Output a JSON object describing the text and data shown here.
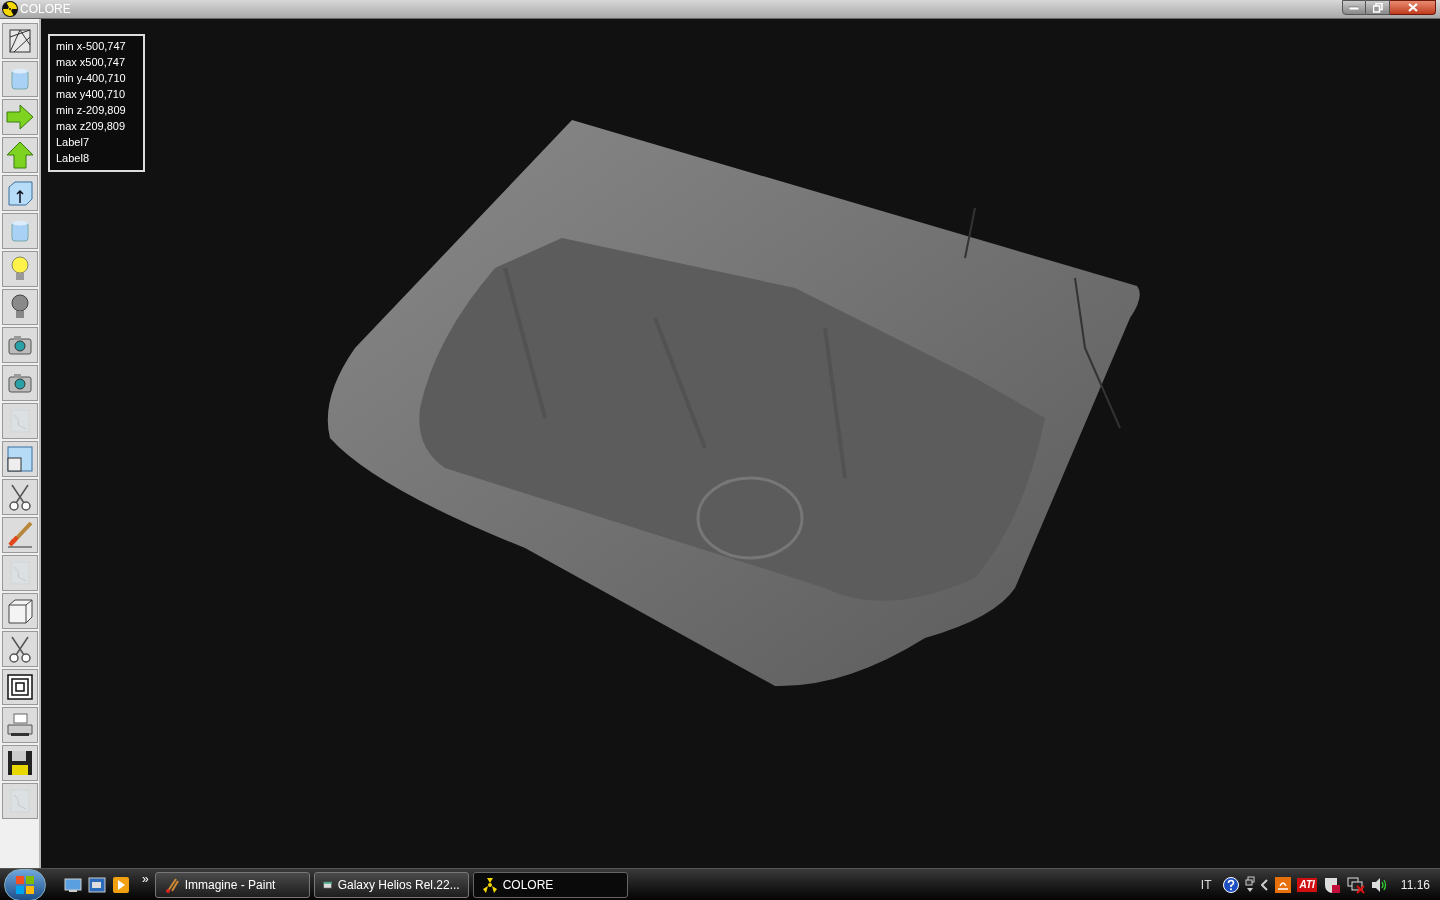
{
  "window": {
    "title": "COLORE"
  },
  "info_labels": [
    "min x-500,747",
    "max x500,747",
    "min y-400,710",
    "max y400,710",
    "min z-209,809",
    "max z209,809",
    "Label7",
    "Label8"
  ],
  "toolbar": [
    {
      "kind": "wireframe",
      "disabled": false
    },
    {
      "kind": "cylinder",
      "disabled": false
    },
    {
      "kind": "arrow-right",
      "disabled": false
    },
    {
      "kind": "arrow-up",
      "disabled": false
    },
    {
      "kind": "box-arrow",
      "disabled": false
    },
    {
      "kind": "cylinder",
      "disabled": false
    },
    {
      "kind": "bulb-on",
      "disabled": false
    },
    {
      "kind": "bulb-off",
      "disabled": false
    },
    {
      "kind": "camera",
      "disabled": false
    },
    {
      "kind": "camera",
      "disabled": false
    },
    {
      "kind": "texture",
      "disabled": true
    },
    {
      "kind": "window",
      "disabled": false
    },
    {
      "kind": "scissors",
      "disabled": false
    },
    {
      "kind": "brush",
      "disabled": false
    },
    {
      "kind": "texture",
      "disabled": true
    },
    {
      "kind": "cube",
      "disabled": false
    },
    {
      "kind": "scissors",
      "disabled": false
    },
    {
      "kind": "squares",
      "disabled": false
    },
    {
      "kind": "printer",
      "disabled": false
    },
    {
      "kind": "floppy",
      "disabled": false
    },
    {
      "kind": "texture",
      "disabled": true
    }
  ],
  "taskbar": {
    "quick_launch": [
      {
        "kind": "desktop"
      },
      {
        "kind": "windows"
      },
      {
        "kind": "media"
      }
    ],
    "overflow": "»",
    "tasks": [
      {
        "label": "Immagine - Paint",
        "kind": "paint",
        "selected": false
      },
      {
        "label": "Galaxy Helios  Rel.22...",
        "kind": "app",
        "selected": false
      },
      {
        "label": "COLORE",
        "kind": "radiation",
        "selected": true
      }
    ],
    "language": "IT",
    "tray_ati": "ATI",
    "clock": "11.16"
  }
}
